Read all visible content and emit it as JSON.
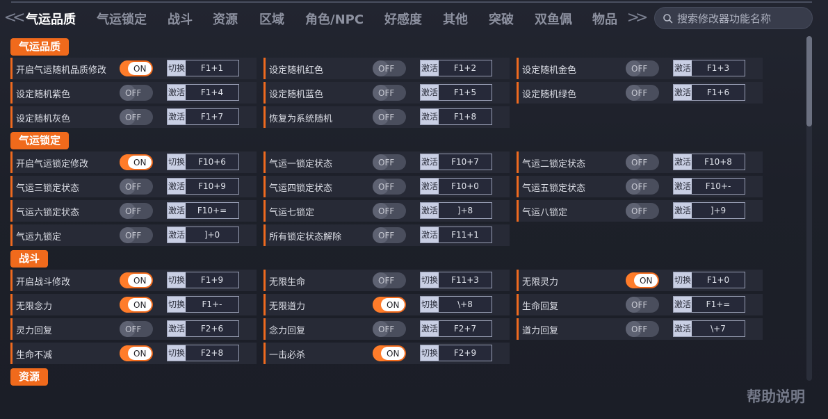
{
  "nav": {
    "left_arrow": "<<",
    "right_arrow": ">>",
    "tabs": [
      {
        "label": "气运品质",
        "active": true
      },
      {
        "label": "气运锁定",
        "active": false
      },
      {
        "label": "战斗",
        "active": false
      },
      {
        "label": "资源",
        "active": false
      },
      {
        "label": "区域",
        "active": false
      },
      {
        "label": "角色/NPC",
        "active": false
      },
      {
        "label": "好感度",
        "active": false
      },
      {
        "label": "其他",
        "active": false
      },
      {
        "label": "突破",
        "active": false
      },
      {
        "label": "双鱼佩",
        "active": false
      },
      {
        "label": "物品",
        "active": false
      }
    ]
  },
  "search": {
    "placeholder": "搜索修改器功能名称"
  },
  "sections": [
    {
      "title": "气运品质",
      "items": [
        {
          "label": "开启气运随机品质修改",
          "state": "ON",
          "mode": "切换",
          "key": "F1+1"
        },
        {
          "label": "设定随机红色",
          "state": "OFF",
          "mode": "激活",
          "key": "F1+2"
        },
        {
          "label": "设定随机金色",
          "state": "OFF",
          "mode": "激活",
          "key": "F1+3"
        },
        {
          "label": "设定随机紫色",
          "state": "OFF",
          "mode": "激活",
          "key": "F1+4"
        },
        {
          "label": "设定随机蓝色",
          "state": "OFF",
          "mode": "激活",
          "key": "F1+5"
        },
        {
          "label": "设定随机绿色",
          "state": "OFF",
          "mode": "激活",
          "key": "F1+6"
        },
        {
          "label": "设定随机灰色",
          "state": "OFF",
          "mode": "激活",
          "key": "F1+7"
        },
        {
          "label": "恢复为系统随机",
          "state": "OFF",
          "mode": "激活",
          "key": "F1+8"
        }
      ]
    },
    {
      "title": "气运锁定",
      "items": [
        {
          "label": "开启气运锁定修改",
          "state": "ON",
          "mode": "切换",
          "key": "F10+6"
        },
        {
          "label": "气运一锁定状态",
          "state": "OFF",
          "mode": "激活",
          "key": "F10+7"
        },
        {
          "label": "气运二锁定状态",
          "state": "OFF",
          "mode": "激活",
          "key": "F10+8"
        },
        {
          "label": "气运三锁定状态",
          "state": "OFF",
          "mode": "激活",
          "key": "F10+9"
        },
        {
          "label": "气运四锁定状态",
          "state": "OFF",
          "mode": "激活",
          "key": "F10+0"
        },
        {
          "label": "气运五锁定状态",
          "state": "OFF",
          "mode": "激活",
          "key": "F10+-"
        },
        {
          "label": "气运六锁定状态",
          "state": "OFF",
          "mode": "激活",
          "key": "F10+="
        },
        {
          "label": "气运七锁定",
          "state": "OFF",
          "mode": "激活",
          "key": "]+8"
        },
        {
          "label": "气运八锁定",
          "state": "OFF",
          "mode": "激活",
          "key": "]+9"
        },
        {
          "label": "气运九锁定",
          "state": "OFF",
          "mode": "激活",
          "key": "]+0"
        },
        {
          "label": "所有锁定状态解除",
          "state": "OFF",
          "mode": "激活",
          "key": "F11+1"
        }
      ]
    },
    {
      "title": "战斗",
      "items": [
        {
          "label": "开启战斗修改",
          "state": "ON",
          "mode": "切换",
          "key": "F1+9"
        },
        {
          "label": "无限生命",
          "state": "OFF",
          "mode": "切换",
          "key": "F11+3"
        },
        {
          "label": "无限灵力",
          "state": "ON",
          "mode": "切换",
          "key": "F1+0"
        },
        {
          "label": "无限念力",
          "state": "ON",
          "mode": "切换",
          "key": "F1+-"
        },
        {
          "label": "无限道力",
          "state": "ON",
          "mode": "切换",
          "key": "\\+8"
        },
        {
          "label": "生命回复",
          "state": "OFF",
          "mode": "激活",
          "key": "F1+="
        },
        {
          "label": "灵力回复",
          "state": "OFF",
          "mode": "激活",
          "key": "F2+6"
        },
        {
          "label": "念力回复",
          "state": "OFF",
          "mode": "激活",
          "key": "F2+7"
        },
        {
          "label": "道力回复",
          "state": "OFF",
          "mode": "激活",
          "key": "\\+7"
        },
        {
          "label": "生命不减",
          "state": "ON",
          "mode": "切换",
          "key": "F2+8"
        },
        {
          "label": "一击必杀",
          "state": "ON",
          "mode": "切换",
          "key": "F2+9"
        }
      ]
    },
    {
      "title": "资源",
      "items": []
    }
  ],
  "help_label": "帮助说明",
  "colors": {
    "accent": "#f06a1c",
    "background": "#1c1f29",
    "cell": "#272a36"
  }
}
